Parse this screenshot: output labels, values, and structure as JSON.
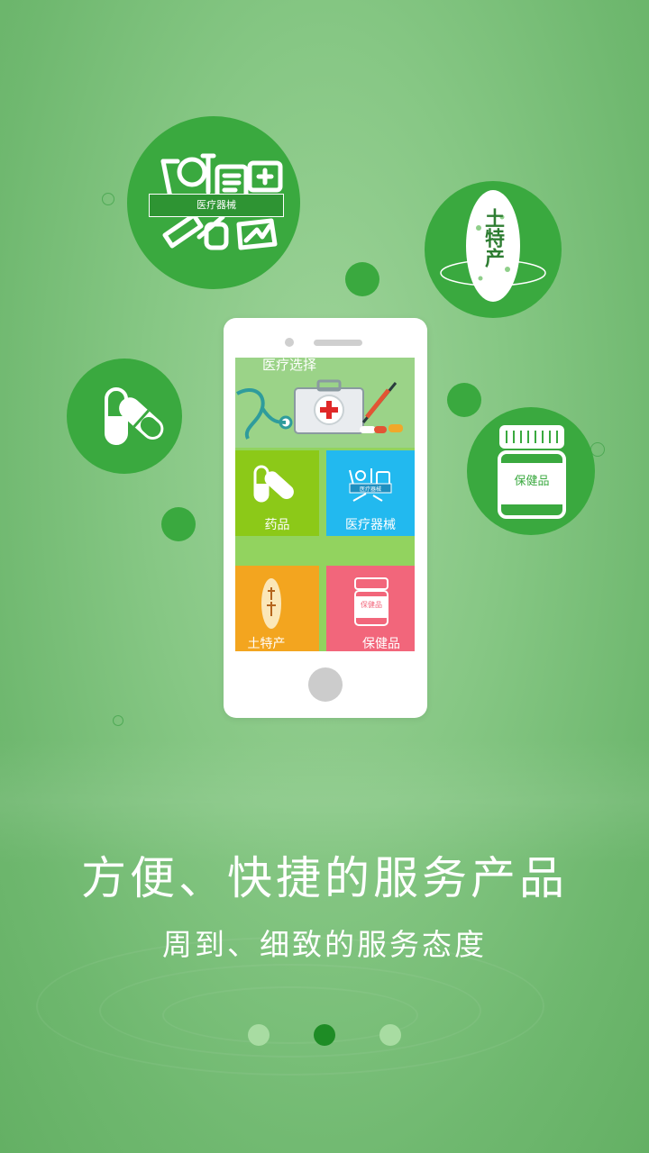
{
  "feature_icons": {
    "medical_device_label": "医疗器械",
    "local_specialty_label": "土特产",
    "health_product_label": "保健品"
  },
  "phone_screen": {
    "banner_title": "医疗选择",
    "tiles": [
      {
        "label": "药品",
        "color": "#8cc918"
      },
      {
        "label": "医疗器械",
        "color": "#22b9ef"
      },
      {
        "label": "土特产",
        "color": "#f3a51f"
      },
      {
        "label": "保健品",
        "color": "#f2667b"
      }
    ],
    "mini_device_label": "医疗器械",
    "mini_health_label": "保健品"
  },
  "headline": "方便、快捷的服务产品",
  "subline": "周到、细致的服务态度",
  "pagination": {
    "total": 3,
    "active_index": 1,
    "active_color": "#1e8c25",
    "inactive_color": "#a8dca2"
  }
}
